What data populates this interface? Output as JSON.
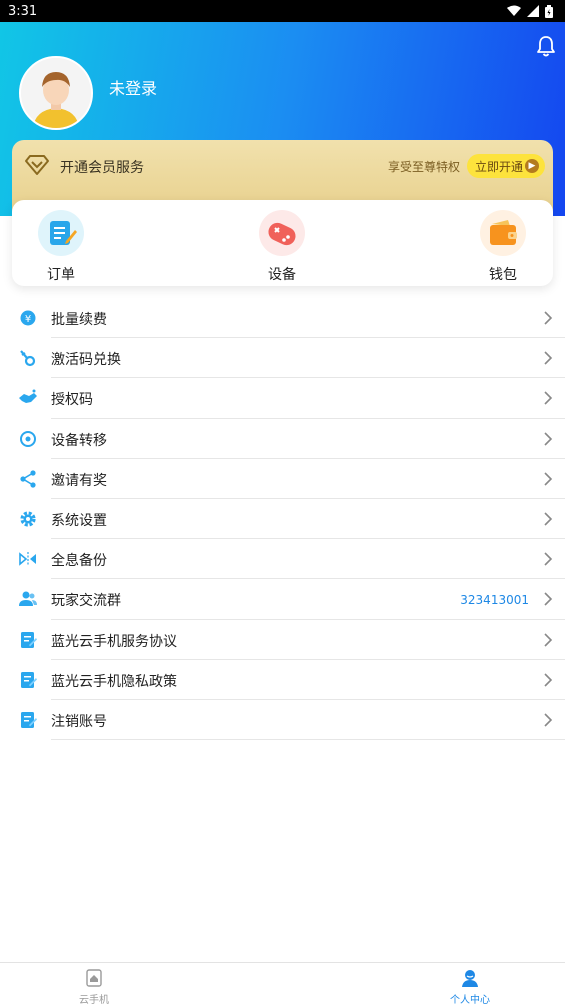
{
  "status_bar": {
    "time": "3:31"
  },
  "profile": {
    "username": "未登录"
  },
  "vip": {
    "title": "开通会员服务",
    "subtitle": "享受至尊特权",
    "button_label": "立即开通"
  },
  "quick_actions": [
    {
      "label": "订单",
      "icon": "order-icon"
    },
    {
      "label": "设备",
      "icon": "gamepad-icon"
    },
    {
      "label": "钱包",
      "icon": "wallet-icon"
    }
  ],
  "menu": [
    {
      "label": "批量续费",
      "icon": "yen-icon",
      "value": ""
    },
    {
      "label": "激活码兑换",
      "icon": "key-icon",
      "value": ""
    },
    {
      "label": "授权码",
      "icon": "handshake-icon",
      "value": ""
    },
    {
      "label": "设备转移",
      "icon": "transfer-icon",
      "value": ""
    },
    {
      "label": "邀请有奖",
      "icon": "share-icon",
      "value": ""
    },
    {
      "label": "系统设置",
      "icon": "gear-icon",
      "value": ""
    },
    {
      "label": "全息备份",
      "icon": "backup-icon",
      "value": ""
    },
    {
      "label": "玩家交流群",
      "icon": "users-icon",
      "value": "323413001"
    },
    {
      "label": "蓝光云手机服务协议",
      "icon": "document-icon",
      "value": ""
    },
    {
      "label": "蓝光云手机隐私政策",
      "icon": "document-icon",
      "value": ""
    },
    {
      "label": "注销账号",
      "icon": "document-icon",
      "value": ""
    }
  ],
  "bottom_nav": [
    {
      "label": "云手机",
      "icon": "phone-icon",
      "active": false
    },
    {
      "label": "个人中心",
      "icon": "person-icon",
      "active": true
    }
  ],
  "colors": {
    "accent": "#1e88e5",
    "header_start": "#11c6e6",
    "header_end": "#1446f0",
    "vip_button": "#fde33c"
  }
}
